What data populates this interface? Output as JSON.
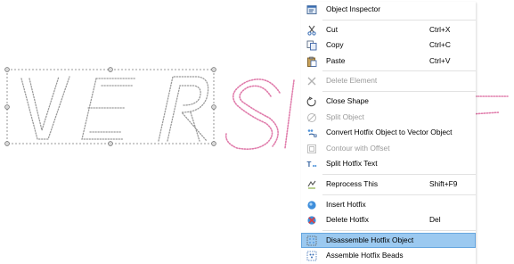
{
  "canvas": {
    "left_text": "VER",
    "right_text": "SION",
    "left_color": "#9a9a9a",
    "right_color": "#e07cab",
    "selection_color": "#7a7a7a"
  },
  "menu": {
    "items": [
      {
        "type": "item",
        "name": "object-inspector",
        "label": "Object Inspector",
        "shortcut": "",
        "icon": "inspector-icon",
        "disabled": false
      },
      {
        "type": "sep"
      },
      {
        "type": "item",
        "name": "cut",
        "label": "Cut",
        "shortcut": "Ctrl+X",
        "icon": "scissors-icon",
        "disabled": false
      },
      {
        "type": "item",
        "name": "copy",
        "label": "Copy",
        "shortcut": "Ctrl+C",
        "icon": "copy-icon",
        "disabled": false
      },
      {
        "type": "item",
        "name": "paste",
        "label": "Paste",
        "shortcut": "Ctrl+V",
        "icon": "paste-icon",
        "disabled": false
      },
      {
        "type": "sep"
      },
      {
        "type": "item",
        "name": "delete-element",
        "label": "Delete Element",
        "shortcut": "",
        "icon": "delete-x-icon",
        "disabled": true
      },
      {
        "type": "sep"
      },
      {
        "type": "item",
        "name": "close-shape",
        "label": "Close Shape",
        "shortcut": "",
        "icon": "close-shape-icon",
        "disabled": false
      },
      {
        "type": "item",
        "name": "split-object",
        "label": "Split Object",
        "shortcut": "",
        "icon": "split-icon",
        "disabled": true
      },
      {
        "type": "item",
        "name": "convert-hotfix",
        "label": "Convert Hotfix Object to Vector Object",
        "shortcut": "",
        "icon": "convert-icon",
        "disabled": false
      },
      {
        "type": "item",
        "name": "contour-offset",
        "label": "Contour with Offset",
        "shortcut": "",
        "icon": "contour-icon",
        "disabled": true
      },
      {
        "type": "item",
        "name": "split-hotfix-text",
        "label": "Split Hotfix Text",
        "shortcut": "",
        "icon": "split-text-icon",
        "disabled": false
      },
      {
        "type": "sep"
      },
      {
        "type": "item",
        "name": "reprocess-this",
        "label": "Reprocess This",
        "shortcut": "Shift+F9",
        "icon": "reprocess-icon",
        "disabled": false
      },
      {
        "type": "sep"
      },
      {
        "type": "item",
        "name": "insert-hotfix",
        "label": "Insert Hotfix",
        "shortcut": "",
        "icon": "insert-hotfix-icon",
        "disabled": false
      },
      {
        "type": "item",
        "name": "delete-hotfix",
        "label": "Delete Hotfix",
        "shortcut": "Del",
        "icon": "delete-hotfix-icon",
        "disabled": false
      },
      {
        "type": "sep"
      },
      {
        "type": "item",
        "name": "disassemble-hotfix",
        "label": "Disassemble Hotfix Object",
        "shortcut": "",
        "icon": "disassemble-icon",
        "disabled": false,
        "highlight": true
      },
      {
        "type": "item",
        "name": "assemble-beads",
        "label": "Assemble Hotfix Beads",
        "shortcut": "",
        "icon": "assemble-icon",
        "disabled": false
      }
    ]
  }
}
